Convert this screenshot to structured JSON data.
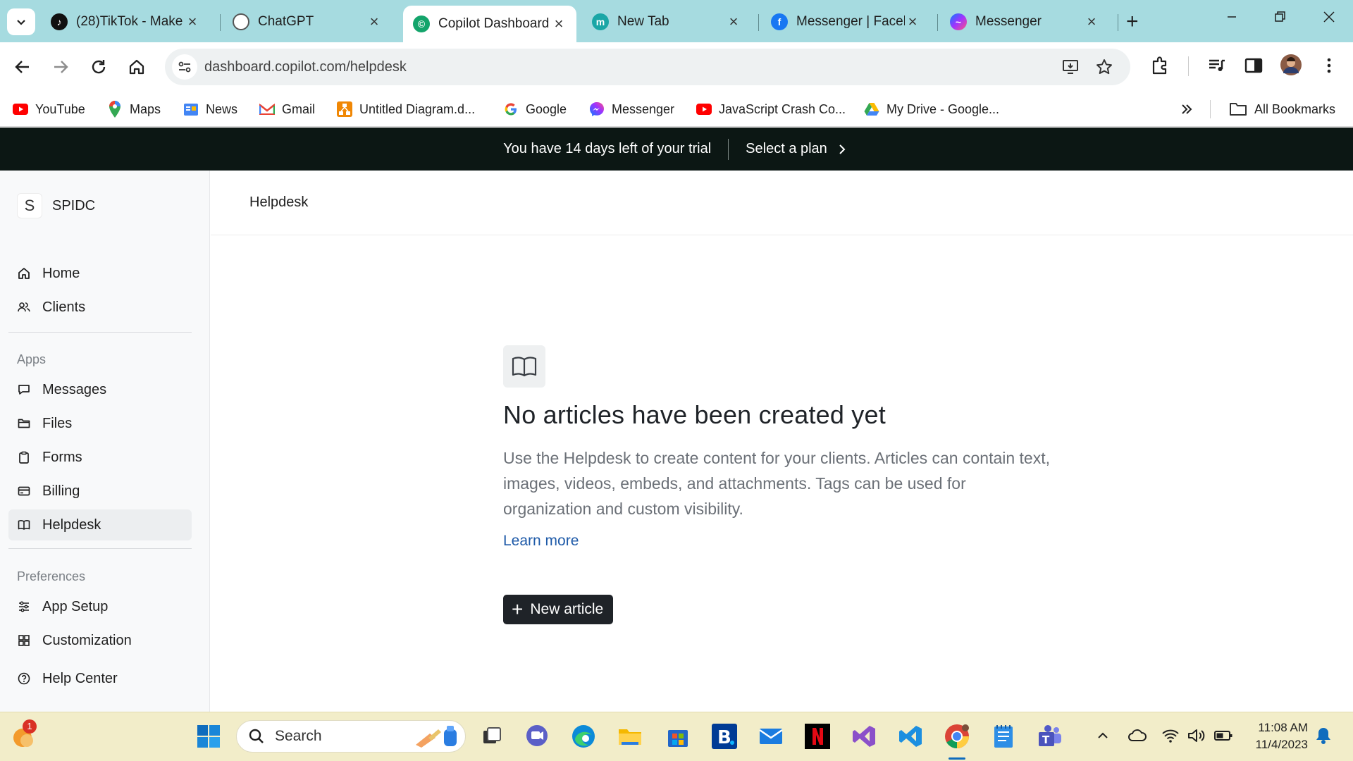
{
  "browser": {
    "tabs": [
      {
        "title": "(28)TikTok - Make",
        "icon": "tiktok-icon"
      },
      {
        "title": "ChatGPT",
        "icon": "chatgpt-icon"
      },
      {
        "title": "Copilot Dashboard",
        "icon": "copilot-icon",
        "active": true
      },
      {
        "title": "New Tab",
        "icon": "new-tab-icon"
      },
      {
        "title": "Messenger | Faceb",
        "icon": "facebook-icon"
      },
      {
        "title": "Messenger",
        "icon": "messenger-icon"
      }
    ],
    "url": "dashboard.copilot.com/helpdesk",
    "bookmarks": [
      {
        "label": "YouTube",
        "icon": "youtube-icon"
      },
      {
        "label": "Maps",
        "icon": "maps-icon"
      },
      {
        "label": "News",
        "icon": "news-icon"
      },
      {
        "label": "Gmail",
        "icon": "gmail-icon"
      },
      {
        "label": "Untitled Diagram.d...",
        "icon": "drawio-icon"
      },
      {
        "label": "Google",
        "icon": "google-icon"
      },
      {
        "label": "Messenger",
        "icon": "messenger-icon"
      },
      {
        "label": "JavaScript Crash Co...",
        "icon": "youtube-icon"
      },
      {
        "label": "My Drive - Google...",
        "icon": "drive-icon"
      }
    ],
    "all_bookmarks": "All Bookmarks"
  },
  "banner": {
    "trial_text": "You have 14 days left of your trial",
    "plan_link": "Select a plan"
  },
  "sidebar": {
    "org_initial": "S",
    "org_name": "SPIDC",
    "primary": [
      {
        "label": "Home",
        "icon": "home-icon"
      },
      {
        "label": "Clients",
        "icon": "clients-icon"
      }
    ],
    "apps_heading": "Apps",
    "apps": [
      {
        "label": "Messages",
        "icon": "message-icon"
      },
      {
        "label": "Files",
        "icon": "folder-icon"
      },
      {
        "label": "Forms",
        "icon": "clipboard-icon"
      },
      {
        "label": "Billing",
        "icon": "credit-card-icon"
      },
      {
        "label": "Helpdesk",
        "icon": "book-icon",
        "active": true
      }
    ],
    "preferences_heading": "Preferences",
    "preferences": [
      {
        "label": "App Setup",
        "icon": "sliders-icon"
      },
      {
        "label": "Customization",
        "icon": "grid-icon"
      }
    ],
    "footer": [
      {
        "label": "Help Center",
        "icon": "help-circle-icon"
      }
    ]
  },
  "main": {
    "page_title": "Helpdesk",
    "empty_title": "No articles have been created yet",
    "empty_description": "Use the Helpdesk to create content for your clients. Articles can contain text, images, videos, embeds, and attachments. Tags can be used for organization and custom visibility.",
    "learn_more": "Learn more",
    "new_article": "New article"
  },
  "taskbar": {
    "search_placeholder": "Search",
    "notification_badge": "1",
    "time": "11:08 AM",
    "date": "11/4/2023"
  },
  "colors": {
    "tabstrip": "#a6dbe0",
    "banner": "#0c1714",
    "primary_button": "#1f2328",
    "link": "#1e5aa8",
    "taskbar": "#f2edc9"
  }
}
